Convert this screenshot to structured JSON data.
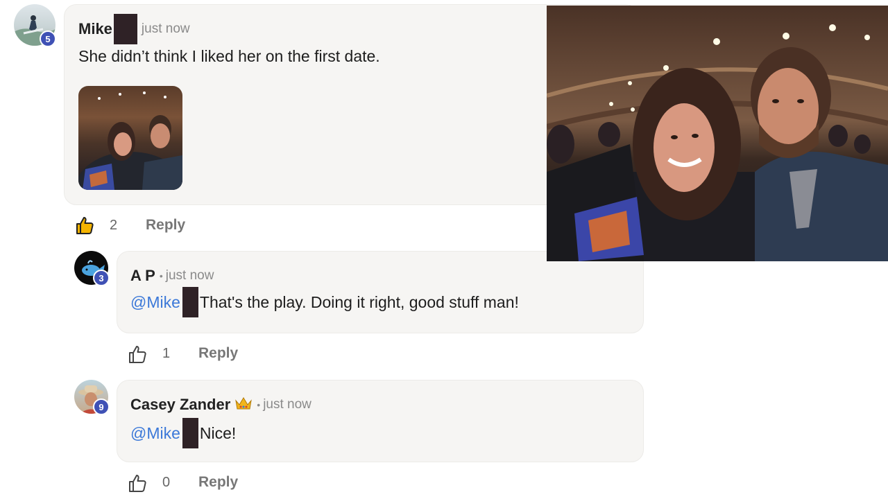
{
  "comments": [
    {
      "author": "Mike",
      "time": "just now",
      "badge": "5",
      "text": "She didn’t think I liked her on the first date.",
      "likes": "2",
      "reply_label": "Reply"
    },
    {
      "author": "A P",
      "separator": "•",
      "time": "just now",
      "badge": "3",
      "mention": "@Mike",
      "text": "That's the play. Doing it right, good stuff man!",
      "likes": "1",
      "reply_label": "Reply"
    },
    {
      "author": "Casey Zander",
      "author_emoji": "crown-icon",
      "separator": "•",
      "time": "just now",
      "badge": "9",
      "mention": "@Mike",
      "text": "Nice!",
      "likes": "0",
      "reply_label": "Reply"
    }
  ],
  "colors": {
    "badge": "#3f51b5",
    "mention": "#3b78d8",
    "bubble": "#f6f5f3",
    "redaction": "#2f2226"
  }
}
